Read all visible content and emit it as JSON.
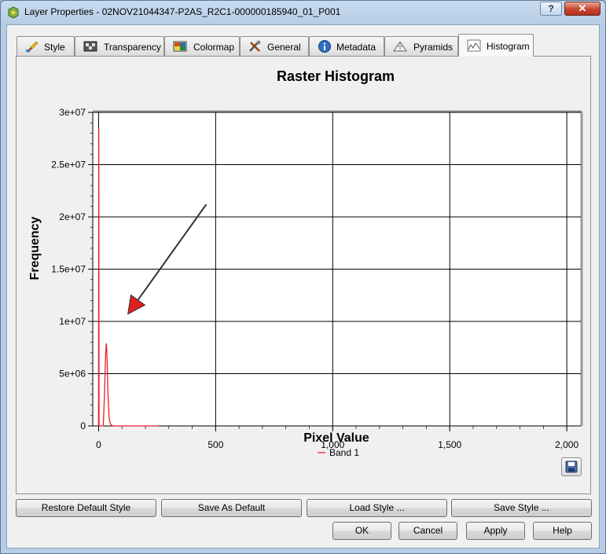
{
  "window": {
    "title": "Layer Properties - 02NOV21044347-P2AS_R2C1-000000185940_01_P001",
    "help_label": "?",
    "close_label": "✕"
  },
  "tabs": [
    {
      "label": "Style",
      "icon": "style-brush-icon"
    },
    {
      "label": "Transparency",
      "icon": "transparency-icon"
    },
    {
      "label": "Colormap",
      "icon": "colormap-icon"
    },
    {
      "label": "General",
      "icon": "tools-icon"
    },
    {
      "label": "Metadata",
      "icon": "info-icon"
    },
    {
      "label": "Pyramids",
      "icon": "pyramid-icon"
    },
    {
      "label": "Histogram",
      "icon": "histogram-icon",
      "active": true
    }
  ],
  "chart_data": {
    "type": "line",
    "title": "Raster Histogram",
    "xlabel": "Pixel Value",
    "ylabel": "Frequency",
    "xlim": [
      -25,
      2060
    ],
    "ylim": [
      0,
      30000000
    ],
    "x_ticks": [
      0,
      500,
      1000,
      1500,
      2000
    ],
    "x_tick_labels": [
      "0",
      "500",
      "1,000",
      "1,500",
      "2,000"
    ],
    "y_ticks": [
      0,
      5000000,
      10000000,
      15000000,
      20000000,
      25000000,
      30000000
    ],
    "y_tick_labels": [
      "0",
      "5e+06",
      "1e+07",
      "1.5e+07",
      "2e+07",
      "2.5e+07",
      "3e+07"
    ],
    "grid": true,
    "legend_position": "bottom",
    "series": [
      {
        "name": "Band 1",
        "color": "#e8202a",
        "x": [
          0,
          1,
          2,
          3,
          5,
          10,
          20,
          25,
          30,
          33,
          36,
          40,
          45,
          50,
          60,
          80,
          120,
          180,
          255
        ],
        "y": [
          0,
          28500000,
          0,
          0,
          0,
          0,
          0,
          3000000,
          7000000,
          7900000,
          6500000,
          3000000,
          800000,
          200000,
          0,
          0,
          0,
          0,
          0
        ]
      }
    ],
    "annotation": {
      "type": "arrow",
      "color": "#e02020",
      "from": [
        460,
        21200000
      ],
      "to": [
        125,
        10700000
      ]
    }
  },
  "buttons": {
    "restore_default_style": "Restore Default Style",
    "save_as_default": "Save As Default",
    "load_style": "Load Style ...",
    "save_style": "Save Style ...",
    "ok": "OK",
    "cancel": "Cancel",
    "apply": "Apply",
    "help": "Help"
  }
}
